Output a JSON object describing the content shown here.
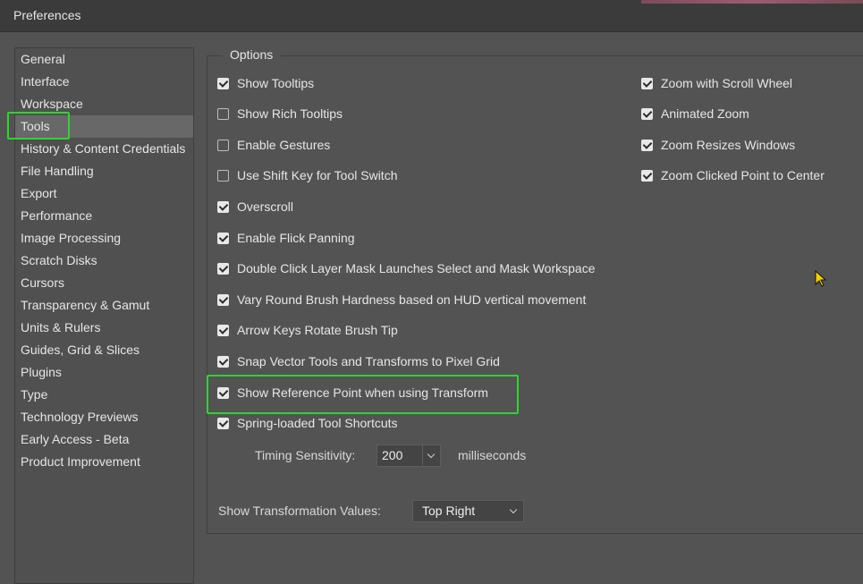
{
  "window": {
    "title": "Preferences"
  },
  "sidebar": {
    "items": [
      {
        "label": "General",
        "selected": false
      },
      {
        "label": "Interface",
        "selected": false
      },
      {
        "label": "Workspace",
        "selected": false
      },
      {
        "label": "Tools",
        "selected": true
      },
      {
        "label": "History & Content Credentials",
        "selected": false
      },
      {
        "label": "File Handling",
        "selected": false
      },
      {
        "label": "Export",
        "selected": false
      },
      {
        "label": "Performance",
        "selected": false
      },
      {
        "label": "Image Processing",
        "selected": false
      },
      {
        "label": "Scratch Disks",
        "selected": false
      },
      {
        "label": "Cursors",
        "selected": false
      },
      {
        "label": "Transparency & Gamut",
        "selected": false
      },
      {
        "label": "Units & Rulers",
        "selected": false
      },
      {
        "label": "Guides, Grid & Slices",
        "selected": false
      },
      {
        "label": "Plugins",
        "selected": false
      },
      {
        "label": "Type",
        "selected": false
      },
      {
        "label": "Technology Previews",
        "selected": false
      },
      {
        "label": "Early Access - Beta",
        "selected": false
      },
      {
        "label": "Product Improvement",
        "selected": false
      }
    ]
  },
  "options": {
    "group_label": "Options",
    "left_column": [
      {
        "label": "Show Tooltips",
        "checked": true
      },
      {
        "label": "Show Rich Tooltips",
        "checked": false
      },
      {
        "label": "Enable Gestures",
        "checked": false
      },
      {
        "label": "Use Shift Key for Tool Switch",
        "checked": false
      },
      {
        "label": "Overscroll",
        "checked": true
      },
      {
        "label": "Enable Flick Panning",
        "checked": true
      },
      {
        "label": "Double Click Layer Mask Launches Select and Mask Workspace",
        "checked": true
      },
      {
        "label": "Vary Round Brush Hardness based on HUD vertical movement",
        "checked": true
      },
      {
        "label": "Arrow Keys Rotate Brush Tip",
        "checked": true
      },
      {
        "label": "Snap Vector Tools and Transforms to Pixel Grid",
        "checked": true
      },
      {
        "label": "Show Reference Point when using Transform",
        "checked": true
      },
      {
        "label": "Spring-loaded Tool Shortcuts",
        "checked": true
      }
    ],
    "right_column": [
      {
        "label": "Zoom with Scroll Wheel",
        "checked": true
      },
      {
        "label": "Animated Zoom",
        "checked": true
      },
      {
        "label": "Zoom Resizes Windows",
        "checked": true
      },
      {
        "label": "Zoom Clicked Point to Center",
        "checked": true
      }
    ],
    "timing_sensitivity": {
      "label": "Timing Sensitivity:",
      "value": "200",
      "unit": "milliseconds"
    },
    "transformation_values": {
      "label": "Show Transformation Values:",
      "value": "Top Right"
    }
  },
  "colors": {
    "highlight": "#2fd42f",
    "panel_bg": "#535353",
    "selected_bg": "#686868"
  }
}
